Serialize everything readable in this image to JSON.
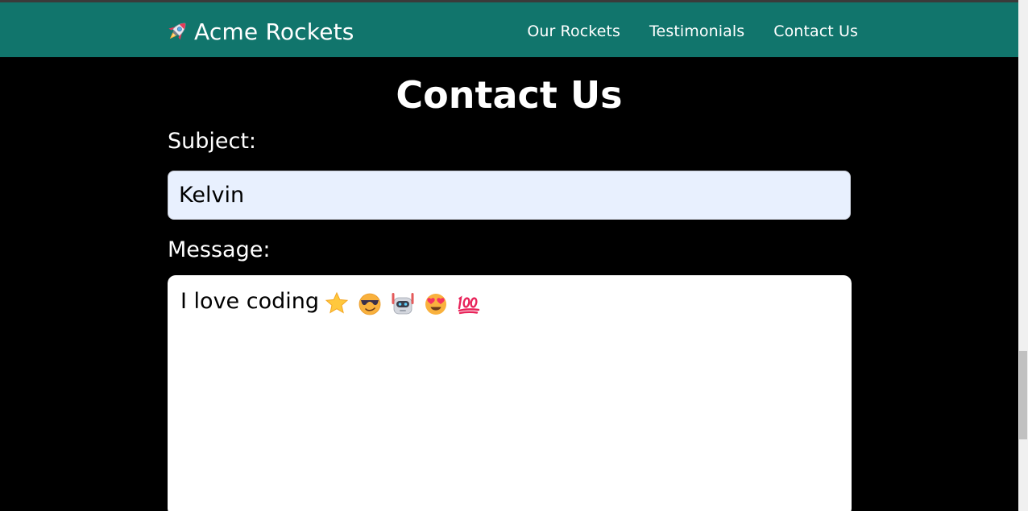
{
  "navbar": {
    "brand_label": "Acme Rockets",
    "brand_icon": "rocket-icon",
    "links": [
      {
        "label": "Our Rockets"
      },
      {
        "label": "Testimonials"
      },
      {
        "label": "Contact Us"
      }
    ],
    "background_color": "#11756c"
  },
  "page": {
    "title": "Contact Us"
  },
  "form": {
    "subject_label": "Subject:",
    "subject_value": "Kelvin",
    "message_label": "Message:",
    "message_text": "I love coding",
    "message_emojis": [
      "star-emoji",
      "sunglasses-face-emoji",
      "robot-emoji",
      "heart-eyes-face-emoji",
      "hundred-points-emoji"
    ]
  }
}
